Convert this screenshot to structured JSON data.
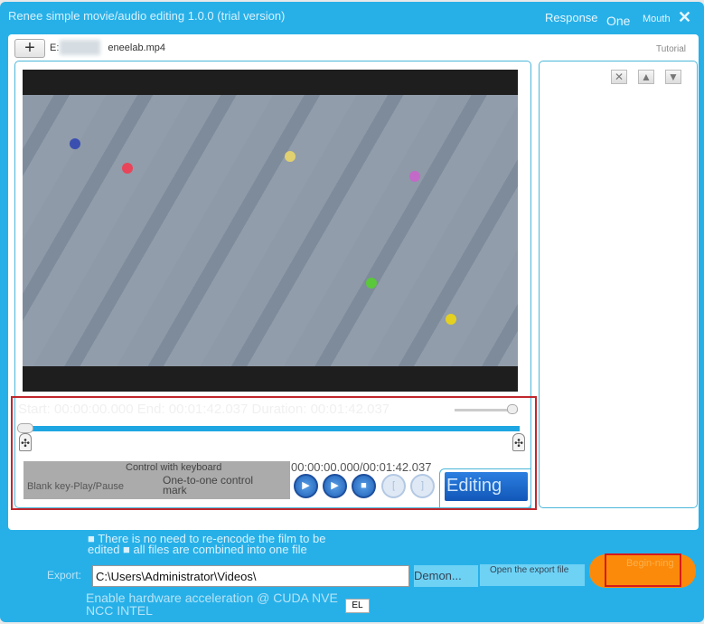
{
  "window": {
    "title": "Renee simple movie/audio editing 1.0.0 (trial version)",
    "controls": [
      "Response",
      "One",
      "Mouth"
    ],
    "close": "✕"
  },
  "file": {
    "add": "+",
    "name_prefix": "E:",
    "name_suffix": "eneelab.mp4",
    "tutorial": "Tutorial"
  },
  "side": {
    "remove": "✕",
    "up": "▲",
    "down": "▼"
  },
  "timeline": {
    "info": "Start: 00:00:00.000 End: 00:01:42.037 Duration: 00:01:42.037",
    "progress_percent": 0,
    "volume_percent": 100,
    "marker": "✣"
  },
  "keyboard": {
    "title": "Control with keyboard",
    "blank": "Blank key-Play/Pause",
    "mark": "One-to-one control mark"
  },
  "player": {
    "time": "00:00:00.000/00:01:42.037",
    "play": "▶",
    "play_segment": "▶",
    "stop": "■",
    "mark_in": "[",
    "mark_out": "]",
    "edit": "Editing"
  },
  "export": {
    "note": "■ There is no need to re-encode the film to be edited ■ all files are combined into one file",
    "label": "Export:",
    "path": "C:\\Users\\Administrator\\Videos\\",
    "browse": "Demon...",
    "open": "Open the export file",
    "start": "Begin-ning",
    "hw": "Enable hardware acceleration @ CUDA NVE NCC INTEL",
    "hw_tag": "EL"
  },
  "colors": {
    "accent": "#27b0e8",
    "start": "#fb8a0a",
    "edit": "#1e6fd0",
    "highlight": "#c0272d"
  }
}
